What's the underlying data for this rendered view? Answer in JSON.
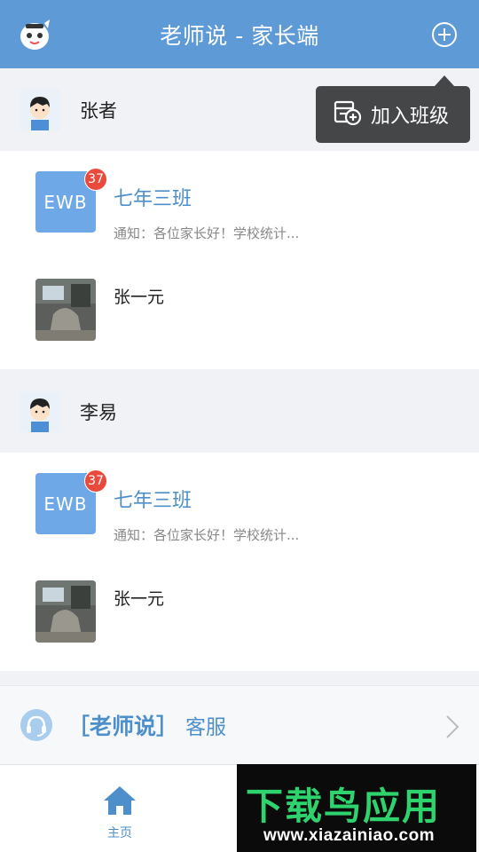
{
  "header": {
    "title": "老师说 - 家长端",
    "logo_icon": "app-mascot-icon",
    "add_icon": "plus-circle-icon"
  },
  "popup": {
    "icon": "add-class-icon",
    "label": "加入班级"
  },
  "children": [
    {
      "name": "张者",
      "avatar_icon": "child-avatar-icon",
      "classes": [
        {
          "thumb_text": "EWB",
          "badge": "37",
          "name": "七年三班",
          "notice": "通知：各位家长好！学校统计..."
        }
      ],
      "members": [
        {
          "name": "张一元"
        }
      ]
    },
    {
      "name": "李易",
      "avatar_icon": "child-avatar-icon",
      "classes": [
        {
          "thumb_text": "EWB",
          "badge": "37",
          "name": "七年三班",
          "notice": "通知：各位家长好！学校统计..."
        }
      ],
      "members": [
        {
          "name": "张一元"
        }
      ]
    }
  ],
  "service": {
    "icon": "headset-icon",
    "brand": "［老师说］",
    "label": "客服",
    "chevron": "chevron-right-icon"
  },
  "tabbar": {
    "home": {
      "icon": "home-icon",
      "label": "主页"
    }
  },
  "watermark": {
    "title": "下载鸟应用",
    "url": "www.xiazainiao.com"
  },
  "colors": {
    "header_bg": "#5d9ad6",
    "accent": "#4d8fca",
    "badge": "#ea4a3c",
    "popup_bg": "#454648"
  }
}
